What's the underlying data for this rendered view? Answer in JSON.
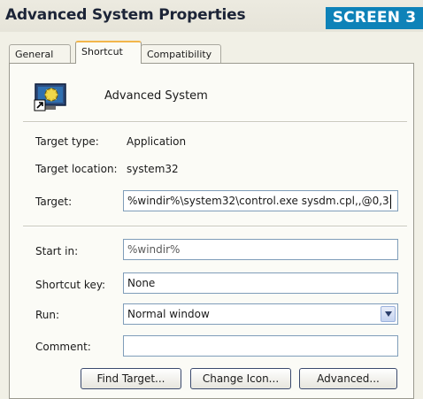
{
  "window": {
    "title": "Advanced System Properties",
    "badge": "SCREEN 3"
  },
  "tabs": [
    {
      "label": "General",
      "active": false
    },
    {
      "label": "Shortcut",
      "active": true
    },
    {
      "label": "Compatibility",
      "active": false
    }
  ],
  "shortcut": {
    "icon": "shortcut-app-icon",
    "name": "Advanced System",
    "target_type_label": "Target type:",
    "target_type_value": "Application",
    "target_location_label": "Target location:",
    "target_location_value": "system32",
    "target_label": "Target:",
    "target_value": "%windir%\\system32\\control.exe sysdm.cpl,,@0,3",
    "start_in_label": "Start in:",
    "start_in_value": "%windir%",
    "shortcut_key_label": "Shortcut key:",
    "shortcut_key_value": "None",
    "run_label": "Run:",
    "run_value": "Normal window",
    "comment_label": "Comment:",
    "comment_value": ""
  },
  "buttons": {
    "find_target": "Find Target...",
    "change_icon": "Change Icon...",
    "advanced": "Advanced..."
  },
  "colors": {
    "badge": "#0e82b8",
    "active_tab_accent": "#f2b64b"
  }
}
